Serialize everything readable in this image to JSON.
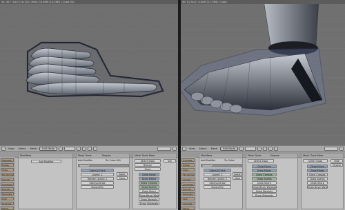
{
  "left_view": {
    "header": "Ve: 307 | Fa:0 | Fa:170 | Mem: 15.60M (13.56M) | Cube.001"
  },
  "right_view": {
    "header": "Ve: 0 | Fa:0 | 4.00M (17.79M) | Cube"
  },
  "toolbar": {
    "view": "View",
    "select": "Select",
    "mesh": "Mesh",
    "mode": "Edit Mode"
  },
  "left_panels": {
    "modifiers_title": "Modifiers",
    "modifiers_tab2": "UV Calculation",
    "add_modifier": "Add Modifier",
    "to_cube": "To: Cube.001",
    "mesh_tools_title": "Mesh Tools",
    "mesh_tools_tab2": "Shapes",
    "mesh_tools_more_title": "Mesh Tools More",
    "subsurf": "Subsurf",
    "catmull_clark": "Catmull-Clark",
    "levels": "Levels: 2",
    "render_levels": "Render Levels: 2",
    "optimal_draw": "Optimal Draw",
    "subsurf_uv": "SubsurfUV",
    "apply": "Apply",
    "copy": "Copy",
    "beauty": "Beauty",
    "short": "Short",
    "draw_faces": "Draw Faces",
    "draw_edges": "Draw Edges",
    "draw_creases": "Draw Creases",
    "draw_seams": "Draw Seams",
    "draw_sharp": "Draw Sharp",
    "draw_bevel_weights": "Draw Bevel Weights",
    "draw_normals": "Draw Normals",
    "draw_vnormals": "Draw VNormals",
    "select_swap": "Select Swap",
    "join": "Join",
    "sidebar": [
      "Translate",
      "Rotate",
      "Scale",
      "Flip Normals",
      "Smooth",
      "Subdivide",
      "Extrude",
      "Duplicate",
      "Split",
      "Separate",
      "Merge"
    ]
  },
  "right_panels": {
    "modifiers_title": "Modifiers",
    "modifiers_tab2": "UV Calculation",
    "add_modifier": "Add Modifier",
    "to_cube": "To: Cube",
    "mesh_tools_title": "Mesh Tools",
    "mesh_tools_tab2": "Shapes",
    "mesh_tools_more_title": "Mesh Tools More",
    "subsurf": "Subsurf",
    "catmull_clark": "Catmull-Clark",
    "levels": "Levels: 2",
    "render_levels": "Render Levels: 2",
    "optimal_draw": "Optimal Draw",
    "subsurf_uv": "SubsurfUV",
    "apply": "Apply",
    "copy": "Copy",
    "draw_faces": "Draw Faces",
    "draw_edges": "Draw Edges",
    "draw_creases": "Draw Creases",
    "draw_seams": "Draw Seams",
    "draw_sharp": "Draw Sharp",
    "draw_bevel_weights": "Draw Bevel Weights",
    "draw_normals": "Draw Normals",
    "draw_vnormals": "Draw VNormals",
    "select_swap": "Select Swap",
    "hide": "Hide",
    "reveal": "Reveal",
    "sidebar": [
      "Translate",
      "Rotate",
      "Scale",
      "Flip Normals",
      "Smooth",
      "Subdivide",
      "Extrude",
      "Duplicate",
      "Split",
      "Separate",
      "Merge"
    ]
  },
  "colors": {
    "viewport_bg": "#707070",
    "mesh_body": "#9aa0aa",
    "mesh_shadow": "#3c3f48",
    "selection_blue": "#7b8ec8",
    "panel_bg": "#c3c3c3",
    "button_bg": "#d5d5d5"
  }
}
